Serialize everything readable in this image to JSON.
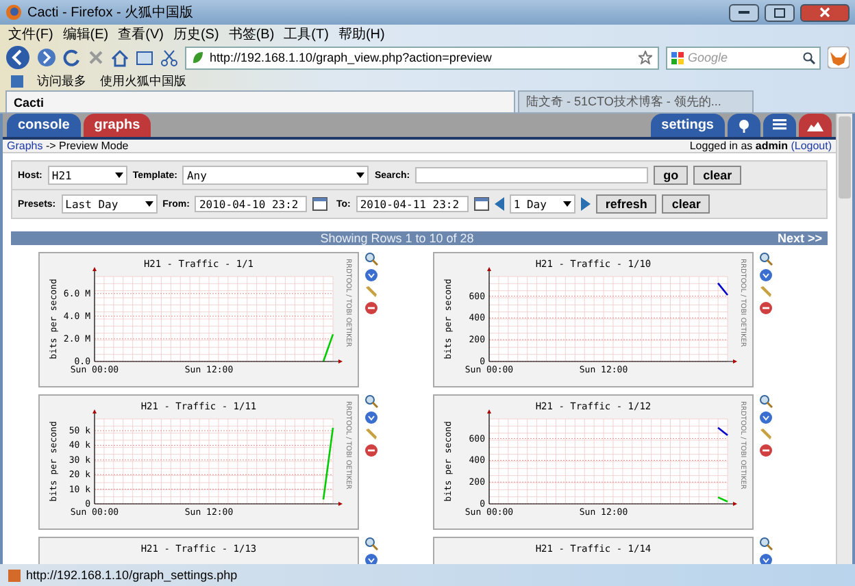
{
  "window": {
    "title": "Cacti - Firefox - 火狐中国版"
  },
  "menu": [
    "文件(F)",
    "编辑(E)",
    "查看(V)",
    "历史(S)",
    "书签(B)",
    "工具(T)",
    "帮助(H)"
  ],
  "address": {
    "value": "http://192.168.1.10/graph_view.php?action=preview"
  },
  "search": {
    "placeholder": "Google"
  },
  "bookmarks": [
    "访问最多",
    "使用火狐中国版"
  ],
  "browser_tabs": [
    {
      "label": "Cacti",
      "selected": true
    },
    {
      "label": "陆文奇 - 51CTO技术博客 - 领先的...",
      "selected": false
    }
  ],
  "cacti_tabs": [
    {
      "label": "console",
      "selected": false
    },
    {
      "label": "graphs",
      "selected": true
    }
  ],
  "cacti_right": {
    "settings": "settings",
    "views": [
      {
        "kind": "tree",
        "selected": false
      },
      {
        "kind": "list",
        "selected": false
      },
      {
        "kind": "preview",
        "selected": true
      }
    ]
  },
  "breadcrumb": {
    "link": "Graphs",
    "rest": "-> Preview Mode",
    "login": "Logged in as **admin**",
    "logout": "(Logout)"
  },
  "filter": {
    "host_label": "Host:",
    "host": "H21",
    "template_label": "Template:",
    "template": "Any",
    "search_label": "Search:",
    "go": "go",
    "clear": "clear",
    "presets_label": "Presets:",
    "preset": "Last Day",
    "from_label": "From:",
    "from": "2010-04-10 23:2",
    "to_label": "To:",
    "to": "2010-04-11 23:2",
    "span": "1 Day",
    "refresh": "refresh",
    "clear2": "clear"
  },
  "pager": {
    "text": "Showing Rows 1 to 10 of 28",
    "next": "Next >>"
  },
  "graphs": [
    {
      "title": "H21 - Traffic - 1/1",
      "credit": "RRDTOOL / TOBI OETIKER",
      "chart_data": {
        "type": "line",
        "grid": true,
        "ylabel": "bits per second",
        "categories": [
          "Sun 00:00",
          null,
          null,
          null,
          null,
          null,
          null,
          null,
          null,
          null,
          null,
          null,
          "Sun 12:00",
          null,
          null,
          null,
          null,
          null,
          null,
          null,
          null,
          null,
          null,
          null,
          null,
          null
        ],
        "ylim": [
          0,
          7500000
        ],
        "yticks": [
          {
            "value": 0,
            "label": "0.0"
          },
          {
            "value": 2000000,
            "label": "2.0 M"
          },
          {
            "value": 4000000,
            "label": "4.0 M"
          },
          {
            "value": 6000000,
            "label": "6.0 M"
          }
        ],
        "series": [
          {
            "color": "#00cc00",
            "values": [
              null,
              null,
              null,
              null,
              null,
              null,
              null,
              null,
              null,
              null,
              null,
              null,
              null,
              null,
              null,
              null,
              null,
              null,
              null,
              null,
              null,
              null,
              null,
              null,
              0,
              2400000
            ]
          }
        ]
      }
    },
    {
      "title": "H21 - Traffic - 1/10",
      "credit": "RRDTOOL / TOBI OETIKER",
      "chart_data": {
        "type": "line",
        "grid": true,
        "ylabel": "bits per second",
        "categories": [
          "Sun 00:00",
          null,
          null,
          null,
          null,
          null,
          null,
          null,
          null,
          null,
          null,
          null,
          "Sun 12:00",
          null,
          null,
          null,
          null,
          null,
          null,
          null,
          null,
          null,
          null,
          null,
          null,
          null
        ],
        "ylim": [
          0,
          780
        ],
        "yticks": [
          0,
          200,
          400,
          600
        ],
        "series": [
          {
            "color": "#0000cc",
            "values": [
              null,
              null,
              null,
              null,
              null,
              null,
              null,
              null,
              null,
              null,
              null,
              null,
              null,
              null,
              null,
              null,
              null,
              null,
              null,
              null,
              null,
              null,
              null,
              null,
              720,
              610
            ]
          }
        ]
      }
    },
    {
      "title": "H21 - Traffic - 1/11",
      "credit": "RRDTOOL / TOBI OETIKER",
      "chart_data": {
        "type": "line",
        "grid": true,
        "ylabel": "bits per second",
        "categories": [
          "Sun 00:00",
          null,
          null,
          null,
          null,
          null,
          null,
          null,
          null,
          null,
          null,
          null,
          "Sun 12:00",
          null,
          null,
          null,
          null,
          null,
          null,
          null,
          null,
          null,
          null,
          null,
          null,
          null
        ],
        "ylim": [
          0,
          58000
        ],
        "yticks": [
          {
            "value": 0,
            "label": "0"
          },
          {
            "value": 10000,
            "label": "10 k"
          },
          {
            "value": 20000,
            "label": "20 k"
          },
          {
            "value": 30000,
            "label": "30 k"
          },
          {
            "value": 40000,
            "label": "40 k"
          },
          {
            "value": 50000,
            "label": "50 k"
          }
        ],
        "series": [
          {
            "color": "#00cc00",
            "values": [
              null,
              null,
              null,
              null,
              null,
              null,
              null,
              null,
              null,
              null,
              null,
              null,
              null,
              null,
              null,
              null,
              null,
              null,
              null,
              null,
              null,
              null,
              null,
              null,
              3000,
              52000
            ]
          }
        ]
      }
    },
    {
      "title": "H21 - Traffic - 1/12",
      "credit": "RRDTOOL / TOBI OETIKER",
      "chart_data": {
        "type": "line",
        "grid": true,
        "ylabel": "bits per second",
        "categories": [
          "Sun 00:00",
          null,
          null,
          null,
          null,
          null,
          null,
          null,
          null,
          null,
          null,
          null,
          "Sun 12:00",
          null,
          null,
          null,
          null,
          null,
          null,
          null,
          null,
          null,
          null,
          null,
          null,
          null
        ],
        "ylim": [
          0,
          780
        ],
        "yticks": [
          0,
          200,
          400,
          600
        ],
        "series": [
          {
            "color": "#00cc00",
            "values": [
              null,
              null,
              null,
              null,
              null,
              null,
              null,
              null,
              null,
              null,
              null,
              null,
              null,
              null,
              null,
              null,
              null,
              null,
              null,
              null,
              null,
              null,
              null,
              null,
              60,
              20
            ]
          },
          {
            "color": "#0000cc",
            "values": [
              null,
              null,
              null,
              null,
              null,
              null,
              null,
              null,
              null,
              null,
              null,
              null,
              null,
              null,
              null,
              null,
              null,
              null,
              null,
              null,
              null,
              null,
              null,
              null,
              700,
              630
            ]
          }
        ]
      }
    },
    {
      "title": "H21 - Traffic - 1/13"
    },
    {
      "title": "H21 - Traffic - 1/14"
    }
  ],
  "status_bar": {
    "text": "http://192.168.1.10/graph_settings.php"
  }
}
